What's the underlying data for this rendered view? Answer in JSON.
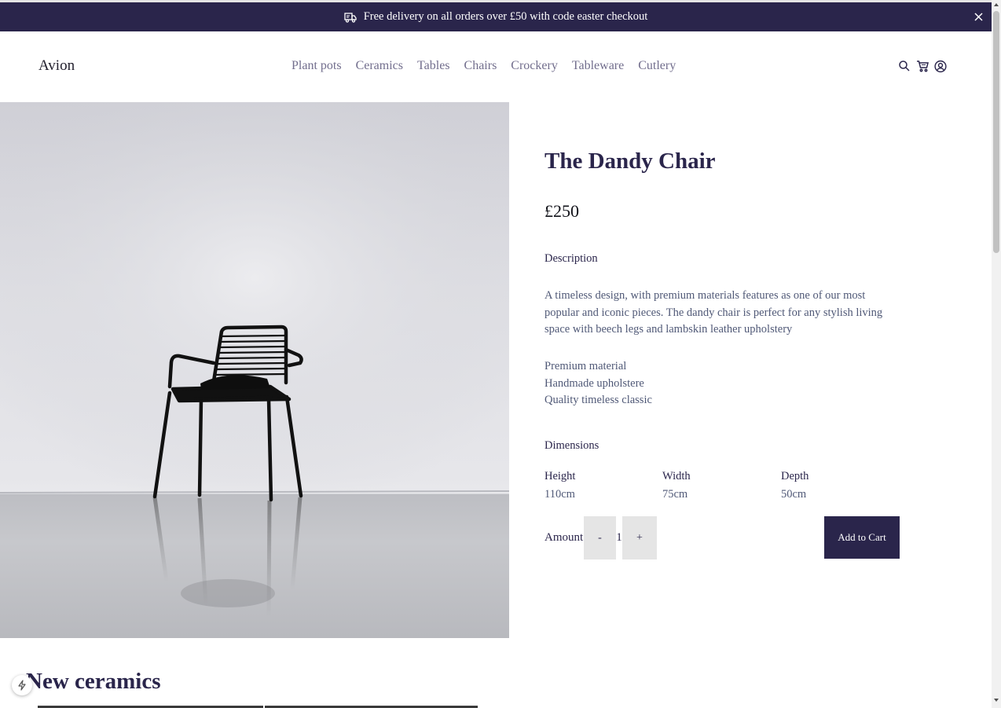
{
  "banner": {
    "text": "Free delivery on all orders over £50 with code easter checkout",
    "icon": "delivery-truck-icon",
    "close_icon": "close-icon"
  },
  "header": {
    "logo": "Avion",
    "nav": [
      "Plant pots",
      "Ceramics",
      "Tables",
      "Chairs",
      "Crockery",
      "Tableware",
      "Cutlery"
    ],
    "icons": [
      "search-icon",
      "cart-icon",
      "user-account-icon"
    ]
  },
  "product": {
    "title": "The Dandy Chair",
    "price": "£250",
    "description_label": "Description",
    "description": "A timeless design, with premium materials features as one of our most popular and iconic pieces. The dandy chair is perfect for any stylish living space with beech legs and lambskin leather upholstery",
    "features": [
      "Premium material",
      "Handmade upholstere",
      "Quality timeless classic"
    ],
    "dimensions_label": "Dimensions",
    "dimensions": [
      {
        "label": "Height",
        "value": "110cm"
      },
      {
        "label": "Width",
        "value": "75cm"
      },
      {
        "label": "Depth",
        "value": "50cm"
      }
    ],
    "amount_label": "Amount",
    "quantity": "1",
    "minus": "-",
    "plus": "+",
    "add_to_cart": "Add to Cart"
  },
  "section": {
    "title": "New ceramics"
  },
  "colors": {
    "brand_dark": "#2A254B",
    "muted_text": "#505977",
    "nav_text": "#726E8D",
    "qty_bg": "#E5E5E5"
  }
}
